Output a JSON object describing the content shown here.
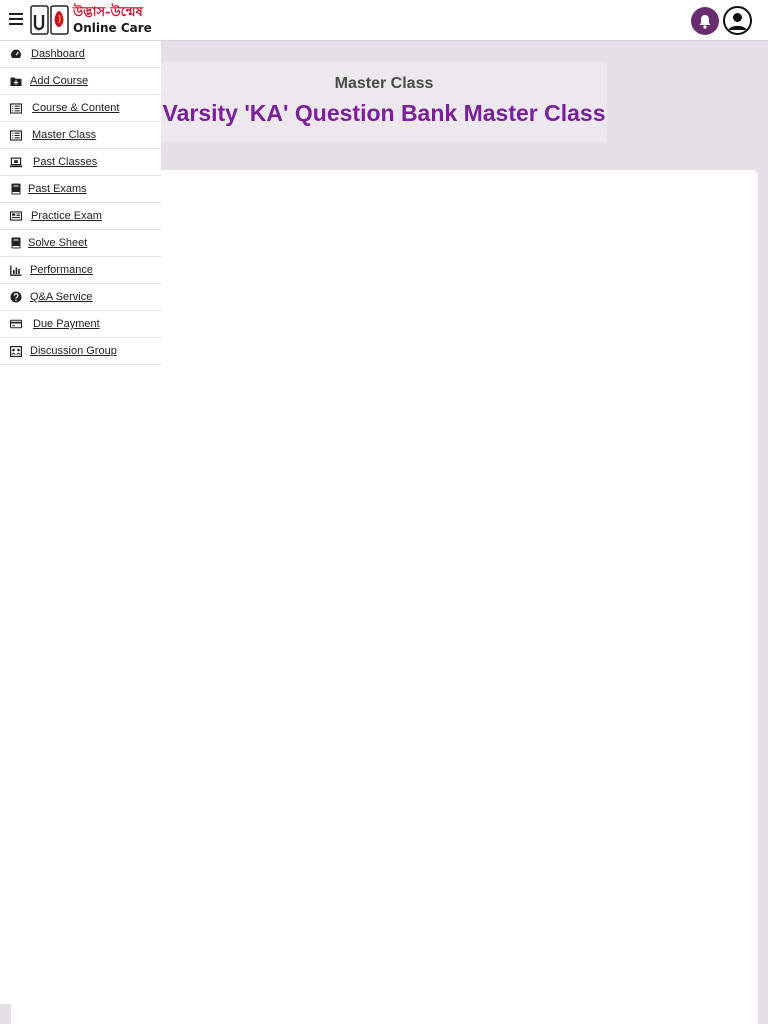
{
  "header": {
    "brand_bn": "উদ্ভাস-উন্মেষ",
    "brand_en": "Online Care",
    "menu_icon": "hamburger-menu-icon",
    "notification_icon": "bell-icon",
    "profile_icon": "user-avatar-icon"
  },
  "sidebar": {
    "items": [
      {
        "label": "Dashboard",
        "icon": "dashboard-gauge-icon"
      },
      {
        "label": "Add Course",
        "icon": "folder-plus-icon"
      },
      {
        "label": "Course & Content",
        "icon": "list-icon"
      },
      {
        "label": "Master Class",
        "icon": "list-icon"
      },
      {
        "label": "Past Classes",
        "icon": "laptop-icon"
      },
      {
        "label": "Past Exams",
        "icon": "book-icon"
      },
      {
        "label": "Practice Exam",
        "icon": "newspaper-icon"
      },
      {
        "label": "Solve Sheet",
        "icon": "book-icon"
      },
      {
        "label": "Performance",
        "icon": "bar-chart-icon"
      },
      {
        "label": "Q&A Service",
        "icon": "question-circle-icon"
      },
      {
        "label": "Due Payment",
        "icon": "credit-card-icon"
      },
      {
        "label": "Discussion Group",
        "icon": "group-chat-icon"
      }
    ]
  },
  "main": {
    "subtitle": "Master Class",
    "title": "Varsity 'KA' Question Bank Master Class"
  },
  "colors": {
    "accent": "#7b1e9c",
    "brand_red": "#c8102e",
    "bell_bg": "#6a2c70",
    "page_bg": "#e6dfe8"
  }
}
